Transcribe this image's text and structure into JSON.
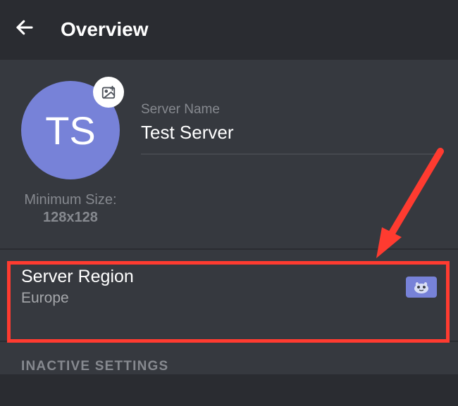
{
  "header": {
    "title": "Overview"
  },
  "server": {
    "initials": "TS",
    "name_label": "Server Name",
    "name_value": "Test Server",
    "min_size_label": "Minimum Size:",
    "min_size_value": "128x128"
  },
  "region": {
    "title": "Server Region",
    "value": "Europe"
  },
  "sections": {
    "inactive": "INACTIVE SETTINGS"
  },
  "annotation": {
    "highlight_color": "#ff3b30"
  }
}
